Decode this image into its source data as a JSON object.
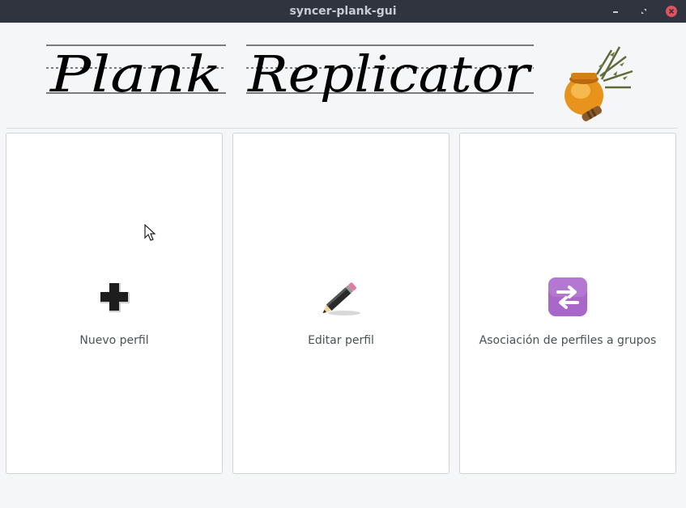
{
  "window": {
    "title": "syncer-plank-gui"
  },
  "banner": {
    "logo_text": "Plank Replicator",
    "honey_pot_icon": "honey-pot-with-herbs"
  },
  "cards": [
    {
      "label": "Nuevo perfil",
      "icon": "plus-icon"
    },
    {
      "label": "Editar perfil",
      "icon": "pencil-icon"
    },
    {
      "label": "Asociación de perfiles a grupos",
      "icon": "swap-arrows-icon"
    }
  ],
  "colors": {
    "titlebar_bg": "#2f343f",
    "close_button": "#e0535d",
    "swap_icon": "#a867c9",
    "window_bg": "#f5f6f7"
  }
}
